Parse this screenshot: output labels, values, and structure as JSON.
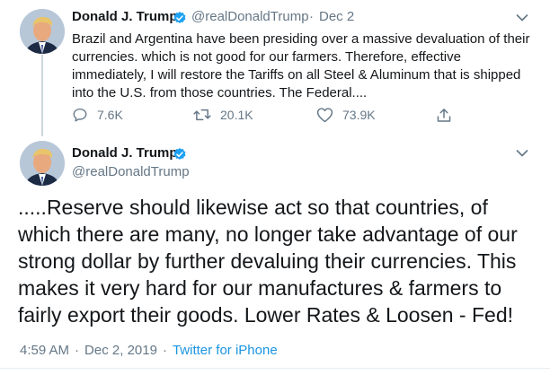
{
  "tweet1": {
    "name": "Donald J. Trump",
    "handle": "@realDonaldTrump",
    "separator": "·",
    "date": "Dec 2",
    "text": "Brazil and Argentina have been presiding over a massive devaluation of their currencies. which is not good for our farmers. Therefore, effective immediately, I will restore the Tariffs on all Steel & Aluminum that is shipped into the U.S. from those countries. The Federal....",
    "replies": "7.6K",
    "retweets": "20.1K",
    "likes": "73.9K"
  },
  "tweet2": {
    "name": "Donald J. Trump",
    "handle": "@realDonaldTrump",
    "text": ".....Reserve should likewise act so that countries, of which there are many, no longer take advantage of our strong dollar by further devaluing their currencies. This makes it very hard for our manufactures & farmers to fairly export their goods. Lower Rates & Loosen - Fed!",
    "time": "4:59 AM",
    "date": "Dec 2, 2019",
    "source": "Twitter for iPhone",
    "separator": "·"
  },
  "icons": [
    "verified-badge-icon",
    "chevron-down-icon",
    "reply-icon",
    "retweet-icon",
    "like-icon",
    "share-icon"
  ],
  "colors": {
    "accent": "#1da1f2",
    "secondary_text": "#657786",
    "source_link": "#1b95e0"
  }
}
